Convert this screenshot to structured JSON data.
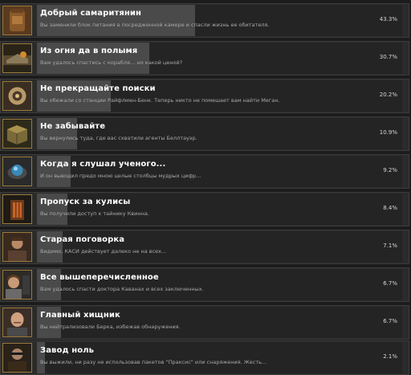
{
  "colors": {
    "background": "#1c1c1c",
    "row": "#2b2b2b",
    "bar_fill": "#4a4a4a",
    "frame": "#9a7a3a"
  },
  "achievements": [
    {
      "icon": "jar-icon",
      "title": "Добрый самаритянин",
      "description": "Вы заменили блок питания в посредженной камере и спасли жизнь ее обитателя.",
      "percent_label": "43.3%",
      "percent": 43.3
    },
    {
      "icon": "fire-ship-icon",
      "title": "Из огня да в полымя",
      "description": "Вам удалось спастись с корабля… но какой ценой?",
      "percent_label": "30.7%",
      "percent": 30.7
    },
    {
      "icon": "drone-icon",
      "title": "Не прекращайте поиски",
      "description": "Вы обежали со станции Райфлмен-Бенк. Теперь никто не помешает вам найти Меган.",
      "percent_label": "20.2%",
      "percent": 20.2
    },
    {
      "icon": "crate-icon",
      "title": "Не забывайте",
      "description": "Вы вернулись туда, где вас схватили агенты Беллтауэр.",
      "percent_label": "10.9%",
      "percent": 10.9
    },
    {
      "icon": "orb-icon",
      "title": "Когда я слушал ученого...",
      "description": "И он выводил предо мною целые столбцы мудрых цифр...",
      "percent_label": "9.2%",
      "percent": 9.2
    },
    {
      "icon": "doorway-icon",
      "title": "Пропуск за кулисы",
      "description": "Вы получили доступ к тайнику Квинна.",
      "percent_label": "8.4%",
      "percent": 8.4
    },
    {
      "icon": "soldier-portrait-icon",
      "title": "Старая поговорка",
      "description": "Видимо, КАСИ действует далеко не на всех...",
      "percent_label": "7.1%",
      "percent": 7.1
    },
    {
      "icon": "doctor-portrait-icon",
      "title": "Все вышеперечисленное",
      "description": "Вам удалось спасти доктора Каванах и всех заключенных.",
      "percent_label": "6.7%",
      "percent": 6.7
    },
    {
      "icon": "bald-man-portrait-icon",
      "title": "Главный хищник",
      "description": "Вы нейтрализовали Берка, избежав обнаружения.",
      "percent_label": "6.7%",
      "percent": 6.7
    },
    {
      "icon": "hero-portrait-icon",
      "title": "Завод ноль",
      "description": "Вы выжили, ни разу не использовав пакетов \"Праксис\" или снаряжения. Жесть...",
      "percent_label": "2.1%",
      "percent": 2.1
    }
  ]
}
